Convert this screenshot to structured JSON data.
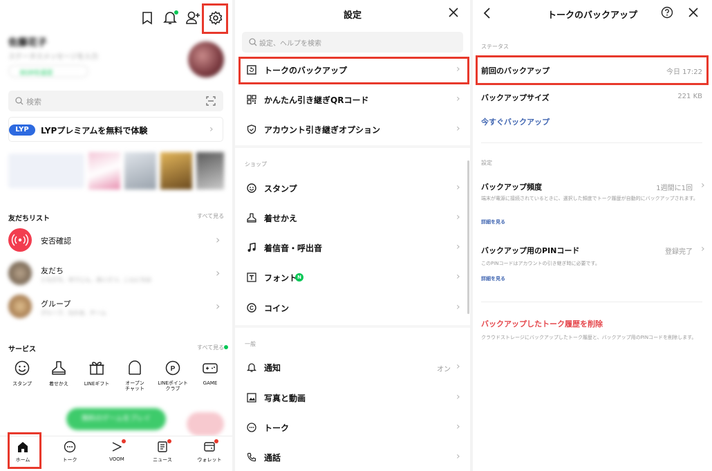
{
  "home": {
    "profile_name": "佐藤花子",
    "status_message": "ステータスメッセージを入力",
    "music_chip": "BGMを設定",
    "search_placeholder": "検索",
    "lyp_badge": "LYP",
    "lyp_text": "LYPプレミアムを無料で体験",
    "friends_section": "友だちリスト",
    "see_all": "すべて見る",
    "friends": [
      {
        "label": "安否確認",
        "sub": ""
      },
      {
        "label": "友だち",
        "sub": "ともだち、ゆうじん、あいさつ、こんにちは"
      },
      {
        "label": "グループ",
        "sub": "グループ、なかま、チーム"
      }
    ],
    "services_section": "サービス",
    "services_see_all": "すべて見る",
    "services": [
      {
        "icon": "smiley-icon",
        "label": "スタンプ"
      },
      {
        "icon": "hanger-icon",
        "label": "着せかえ"
      },
      {
        "icon": "gift-icon",
        "label": "LINEギフト"
      },
      {
        "icon": "open-chat-icon",
        "label": "オープン\nチャット"
      },
      {
        "icon": "points-icon",
        "label": "LINEポイント\nクラブ"
      },
      {
        "icon": "game-icon",
        "label": "GAME"
      }
    ],
    "promo_button": "無料のゲームをプレイ",
    "tabs": [
      {
        "icon": "home-icon",
        "label": "ホーム"
      },
      {
        "icon": "talk-icon",
        "label": "トーク"
      },
      {
        "icon": "voom-icon",
        "label": "VOOM"
      },
      {
        "icon": "news-icon",
        "label": "ニュース"
      },
      {
        "icon": "wallet-icon",
        "label": "ウォレット"
      }
    ]
  },
  "settings": {
    "title": "設定",
    "search_placeholder": "設定、ヘルプを検索",
    "group1": [
      {
        "icon": "backup-icon",
        "label": "トークのバックアップ"
      },
      {
        "icon": "qr-code-icon",
        "label": "かんたん引き継ぎQRコード"
      },
      {
        "icon": "shield-icon",
        "label": "アカウント引き継ぎオプション"
      }
    ],
    "shop_header": "ショップ",
    "shop": [
      {
        "icon": "smiley-icon",
        "label": "スタンプ"
      },
      {
        "icon": "hanger-icon",
        "label": "着せかえ"
      },
      {
        "icon": "music-note-icon",
        "label": "着信音・呼出音"
      },
      {
        "icon": "font-icon",
        "label": "フォント",
        "badge": "N"
      },
      {
        "icon": "coin-icon",
        "label": "コイン"
      }
    ],
    "general_header": "一般",
    "general": [
      {
        "icon": "bell-icon",
        "label": "通知",
        "value": "オン"
      },
      {
        "icon": "photo-icon",
        "label": "写真と動画",
        "value": ""
      },
      {
        "icon": "chat-icon",
        "label": "トーク",
        "value": ""
      },
      {
        "icon": "phone-icon",
        "label": "通話",
        "value": ""
      }
    ]
  },
  "backup": {
    "title": "トークのバックアップ",
    "status_header": "ステータス",
    "last_backup_label": "前回のバックアップ",
    "last_backup_value": "今日 17:22",
    "size_label": "バックアップサイズ",
    "size_value": "221 KB",
    "backup_now": "今すぐバックアップ",
    "settings_header": "設定",
    "frequency_label": "バックアップ頻度",
    "frequency_value": "1週間に1回",
    "frequency_desc": "端末が電源に接続されているときに、選択した頻度でトーク履歴が自動的にバックアップされます。",
    "details": "詳細を見る",
    "pin_label": "バックアップ用のPINコード",
    "pin_value": "登録完了",
    "pin_desc": "このPINコードはアカウントの引き継ぎ時に必要です。",
    "pin_details": "詳細を見る",
    "delete_label": "バックアップしたトーク履歴を削除",
    "delete_desc": "クラウドストレージにバックアップしたトーク履歴と、バックアップ用のPINコードを削除します。",
    "accent": "#e5484d"
  }
}
